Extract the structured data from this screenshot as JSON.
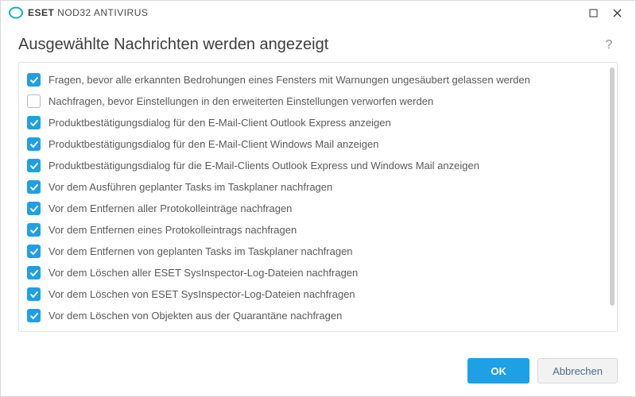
{
  "brand": {
    "name_strong": "ESET",
    "name_rest": " NOD32 ANTIVIRUS"
  },
  "header": {
    "title": "Ausgewählte Nachrichten werden angezeigt"
  },
  "help": {
    "symbol": "?"
  },
  "items": [
    {
      "checked": true,
      "label": "Fragen, bevor alle erkannten Bedrohungen eines Fensters mit Warnungen ungesäubert gelassen werden"
    },
    {
      "checked": false,
      "label": "Nachfragen, bevor Einstellungen in den erweiterten Einstellungen verworfen werden"
    },
    {
      "checked": true,
      "label": "Produktbestätigungsdialog für den E-Mail-Client Outlook Express anzeigen"
    },
    {
      "checked": true,
      "label": "Produktbestätigungsdialog für den E-Mail-Client Windows Mail anzeigen"
    },
    {
      "checked": true,
      "label": "Produktbestätigungsdialog für die E-Mail-Clients Outlook Express und Windows Mail anzeigen"
    },
    {
      "checked": true,
      "label": "Vor dem Ausführen geplanter Tasks im Taskplaner nachfragen"
    },
    {
      "checked": true,
      "label": "Vor dem Entfernen aller Protokolleinträge nachfragen"
    },
    {
      "checked": true,
      "label": "Vor dem Entfernen eines Protokolleintrags nachfragen"
    },
    {
      "checked": true,
      "label": "Vor dem Entfernen von geplanten Tasks im Taskplaner nachfragen"
    },
    {
      "checked": true,
      "label": "Vor dem Löschen aller ESET SysInspector-Log-Dateien nachfragen"
    },
    {
      "checked": true,
      "label": "Vor dem Löschen von ESET SysInspector-Log-Dateien nachfragen"
    },
    {
      "checked": true,
      "label": "Vor dem Löschen von Objekten aus der Quarantäne nachfragen"
    }
  ],
  "footer": {
    "ok": "OK",
    "cancel": "Abbrechen"
  },
  "colors": {
    "accent": "#1ea0e6"
  }
}
